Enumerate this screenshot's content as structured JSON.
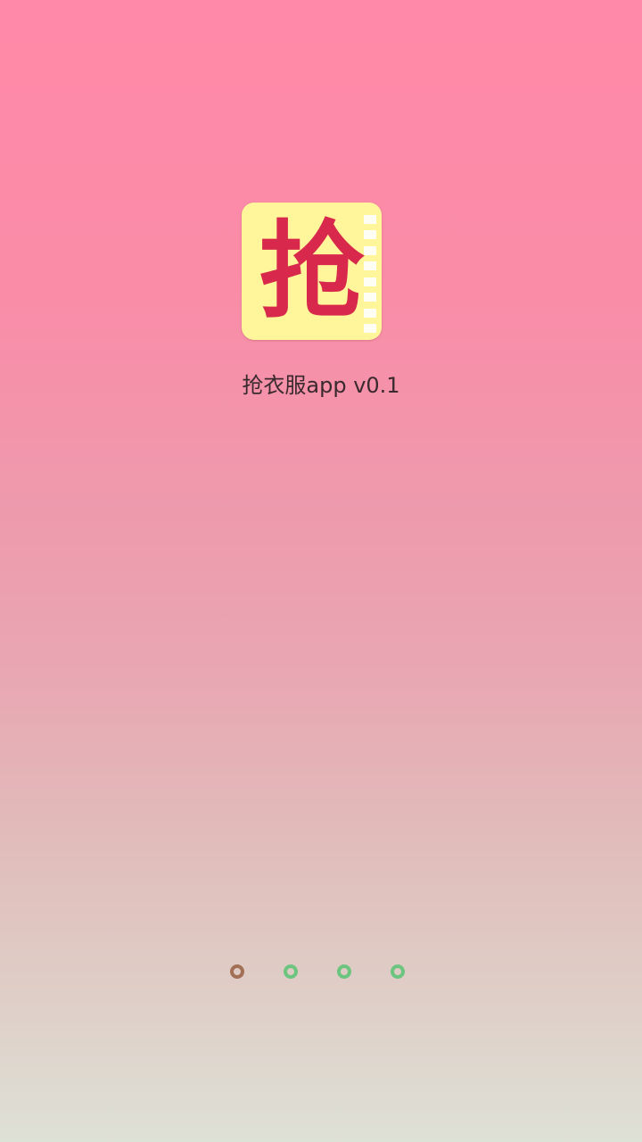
{
  "splash": {
    "icon_glyph": "抢",
    "icon_name": "app-logo-icon",
    "title": "抢衣服app v0.1",
    "colors": {
      "bg_top": "#ff89a8",
      "bg_bottom": "#dee1d6",
      "icon_bg": "#fff59a",
      "icon_glyph": "#d8294c",
      "dot_active": "#a36f55",
      "dot_inactive": "#6cc57f"
    },
    "loading_dots": {
      "count": 4,
      "active_index": 0
    }
  }
}
